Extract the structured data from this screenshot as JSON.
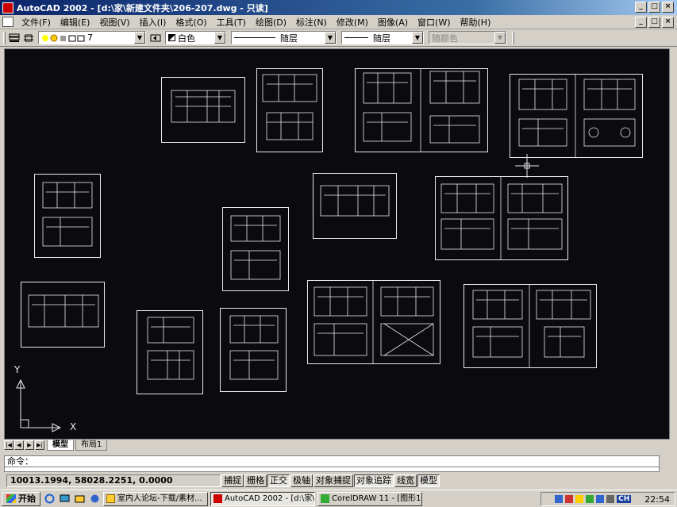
{
  "window": {
    "title": "AutoCAD 2002 - [d:\\家\\新建文件夹\\206-207.dwg - 只读]"
  },
  "window_buttons": [
    "_",
    "□",
    "×"
  ],
  "menu": [
    "文件(F)",
    "编辑(E)",
    "视图(V)",
    "插入(I)",
    "格式(O)",
    "工具(T)",
    "绘图(D)",
    "标注(N)",
    "修改(M)",
    "图像(A)",
    "窗口(W)",
    "帮助(H)"
  ],
  "toolbar": {
    "layer": "7",
    "color": "白色",
    "linetype": "随层",
    "lineweight": "随层",
    "plotstyle": "随颜色"
  },
  "ucs": {
    "x_label": "X",
    "y_label": "Y"
  },
  "layout_tabs": [
    "模型",
    "布局1"
  ],
  "command": {
    "prompt": "命令："
  },
  "status": {
    "coords": "10013.1994, 58028.2251, 0.0000",
    "buttons": [
      "捕捉",
      "栅格",
      "正交",
      "极轴",
      "对象捕捉",
      "对象追踪",
      "线宽",
      "模型"
    ]
  },
  "taskbar": {
    "start": "开始",
    "tasks": [
      "室内人论坛-下载/素材...",
      "AutoCAD 2002 - [d:\\家\\...",
      "CorelDRAW 11 - [图形1]"
    ],
    "tray_lang": "CH",
    "clock": "22:54"
  },
  "colors": {
    "canvas": "#0b0b0f",
    "titlebar": "#0a246a",
    "drawing": "#e8e8e8"
  }
}
